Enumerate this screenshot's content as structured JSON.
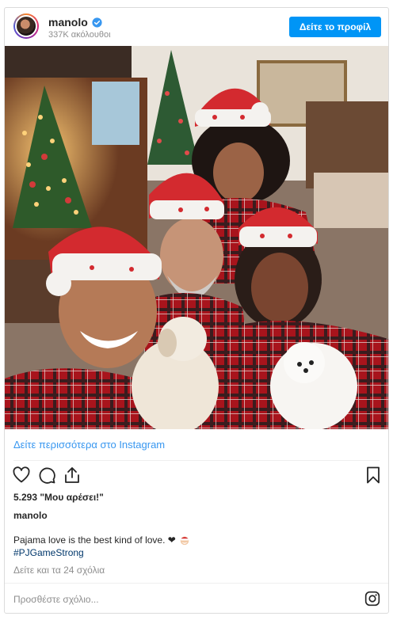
{
  "post": {
    "username": "manolo",
    "followers": "337K ακόλουθοι",
    "profile_button": "Δείτε το προφίλ",
    "more_link": "Δείτε περισσότερα στο Instagram",
    "likes": "5.293 \"Μου αρέσει!\"",
    "owner": "manolo",
    "caption": "Pajama love is the best kind of love. ❤",
    "hashtag": "#PJGameStrong",
    "comments_link": "Δείτε και τα 24 σχόλια",
    "comment_placeholder": "Προσθέστε σχόλιο..."
  },
  "colors": {
    "accent_button": "#0095f6",
    "link": "#00376b",
    "muted": "#8e8e8e",
    "verified": "#3897f0"
  },
  "icons": [
    "verified-icon",
    "heart-icon",
    "comment-icon",
    "share-icon",
    "bookmark-icon",
    "santa-emoji-icon",
    "instagram-logo-icon"
  ]
}
